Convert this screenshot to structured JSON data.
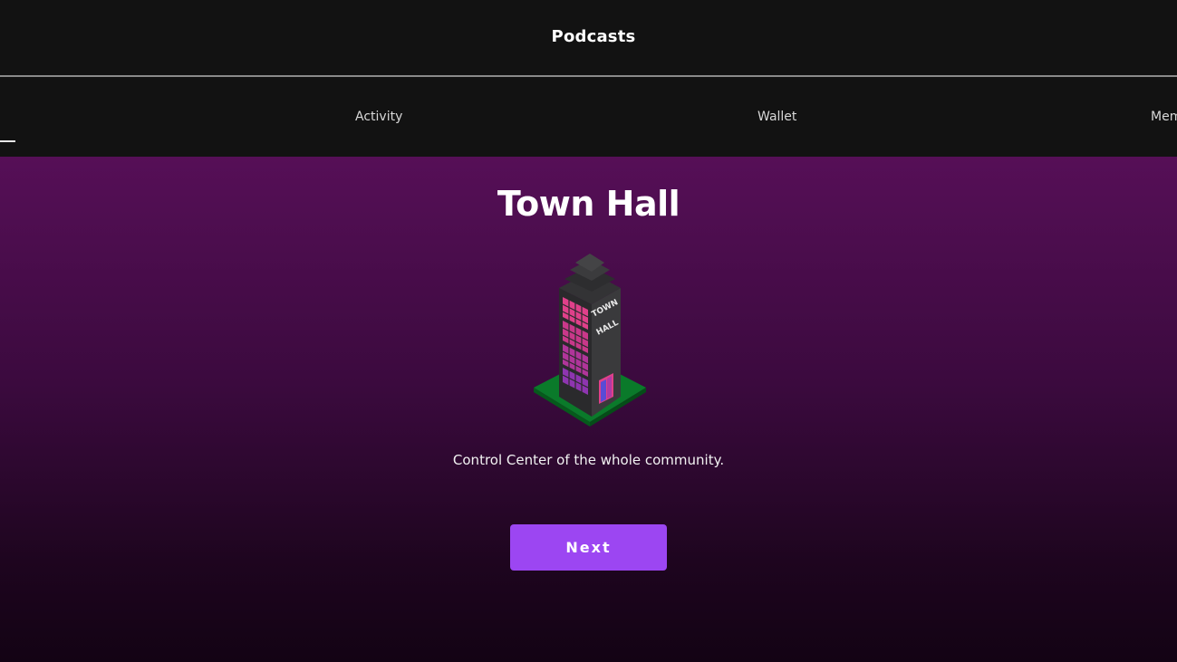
{
  "header": {
    "title": "Podcasts"
  },
  "tabs": [
    {
      "label": "Activity"
    },
    {
      "label": "Wallet"
    },
    {
      "label": "Mem"
    }
  ],
  "main": {
    "title": "Town Hall",
    "illustration_sign": [
      "TOWN",
      "HALL"
    ],
    "description": "Control Center of the whole community.",
    "next_label": "Next"
  },
  "colors": {
    "background": "#121212",
    "gradient_top": "#560f57",
    "gradient_bottom": "#130314",
    "accent": "#9c46f2",
    "window_pink": "#e0408a",
    "lawn_green": "#0a7a2a"
  },
  "icons": [
    "town-hall-building-icon"
  ]
}
